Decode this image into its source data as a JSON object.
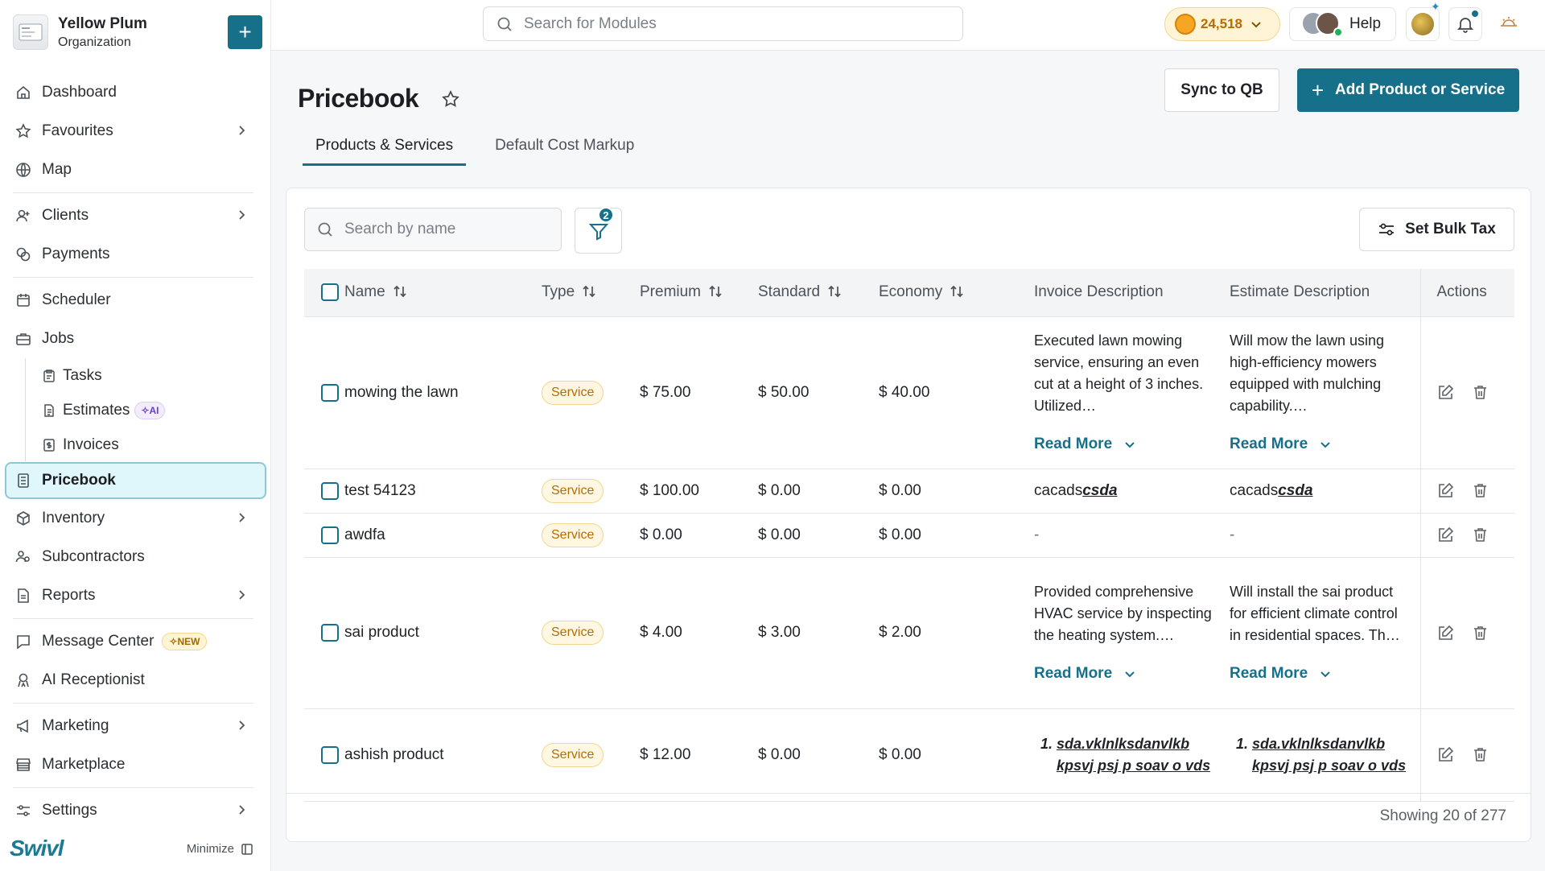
{
  "org": {
    "name": "Yellow Plum",
    "subtitle": "Organization",
    "add_label": "+"
  },
  "nav": {
    "dashboard": "Dashboard",
    "favourites": "Favourites",
    "map": "Map",
    "clients": "Clients",
    "payments": "Payments",
    "scheduler": "Scheduler",
    "jobs": "Jobs",
    "tasks": "Tasks",
    "estimates": "Estimates",
    "estimates_badge": "AI",
    "invoices": "Invoices",
    "pricebook": "Pricebook",
    "inventory": "Inventory",
    "subcontractors": "Subcontractors",
    "reports": "Reports",
    "message_center": "Message Center",
    "message_center_badge": "NEW",
    "ai_receptionist": "AI Receptionist",
    "marketing": "Marketing",
    "marketplace": "Marketplace",
    "settings": "Settings"
  },
  "footer": {
    "brand": "Swivl",
    "minimize": "Minimize"
  },
  "topbar": {
    "search_placeholder": "Search for Modules",
    "coins": "24,518",
    "help": "Help"
  },
  "page": {
    "title": "Pricebook",
    "sync_label": "Sync to QB",
    "add_label": "Add Product or Service",
    "tabs": [
      "Products & Services",
      "Default Cost Markup"
    ]
  },
  "toolbar": {
    "search_placeholder": "Search by name",
    "filter_count": "2",
    "bulk_tax": "Set Bulk Tax"
  },
  "table": {
    "headers": {
      "name": "Name",
      "type": "Type",
      "premium": "Premium",
      "standard": "Standard",
      "economy": "Economy",
      "invoice": "Invoice Description",
      "estimate": "Estimate Description",
      "actions": "Actions"
    },
    "read_more": "Read More",
    "rows": [
      {
        "name": "mowing the lawn",
        "type": "Service",
        "premium": "$ 75.00",
        "standard": "$ 50.00",
        "economy": "$ 40.00",
        "invoice": "Executed lawn mowing service, ensuring an even cut at a height of 3 inches. Utilized…",
        "estimate": "Will mow the lawn using high-efficiency mowers equipped with mulching capability.…"
      },
      {
        "name": "test 54123",
        "type": "Service",
        "premium": "$ 100.00",
        "standard": "$ 0.00",
        "economy": "$ 0.00",
        "invoice_plain": "cacads",
        "invoice_em": "csda",
        "estimate_plain": "cacads",
        "estimate_em": "csda"
      },
      {
        "name": "awdfa",
        "type": "Service",
        "premium": "$ 0.00",
        "standard": "$ 0.00",
        "economy": "$ 0.00",
        "invoice": "-",
        "estimate": "-"
      },
      {
        "name": "sai product",
        "type": "Service",
        "premium": "$ 4.00",
        "standard": "$ 3.00",
        "economy": "$ 2.00",
        "invoice": "Provided comprehensive HVAC service by inspecting the heating system.…",
        "estimate": "Will install the sai product for efficient climate control in residential spaces. Th…"
      },
      {
        "name": "ashish product",
        "type": "Service",
        "premium": "$ 12.00",
        "standard": "$ 0.00",
        "economy": "$ 0.00",
        "invoice": "sda.vklnlksdanvlkb kpsvj psj p soav o vds",
        "estimate": "sda.vklnlksdanvlkb kpsvj psj p soav o vds"
      }
    ]
  },
  "showing": "Showing 20 of 277",
  "colors": {
    "primary": "#17708a",
    "active_bg": "#dff6fb",
    "pill": "#b86b00"
  }
}
